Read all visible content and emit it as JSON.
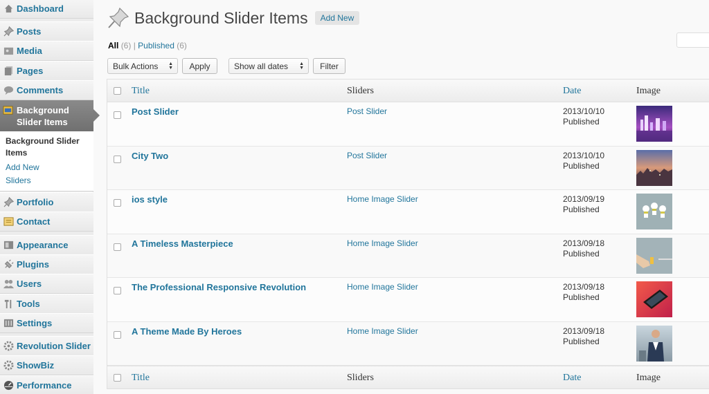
{
  "sidebar": {
    "dashboard": "Dashboard",
    "posts": "Posts",
    "media": "Media",
    "pages": "Pages",
    "comments": "Comments",
    "active": "Background Slider Items",
    "submenu": [
      "Background Slider Items",
      "Add New",
      "Sliders"
    ],
    "portfolio": "Portfolio",
    "contact": "Contact",
    "appearance": "Appearance",
    "plugins": "Plugins",
    "users": "Users",
    "tools": "Tools",
    "settings": "Settings",
    "revolution": "Revolution Slider",
    "showbiz": "ShowBiz",
    "performance": "Performance"
  },
  "header": {
    "title": "Background Slider Items",
    "add_new": "Add New"
  },
  "filters": {
    "all": "All",
    "all_count": "(6)",
    "separator": "|",
    "published": "Published",
    "published_count": "(6)"
  },
  "toolbar": {
    "bulk_actions": "Bulk Actions",
    "apply": "Apply",
    "dates": "Show all dates",
    "filter": "Filter"
  },
  "table": {
    "columns": {
      "title": "Title",
      "sliders": "Sliders",
      "date": "Date",
      "image": "Image"
    },
    "rows": [
      {
        "title": "Post Slider",
        "slider": "Post Slider",
        "date": "2013/10/10",
        "status": "Published",
        "image": "city-night-purple"
      },
      {
        "title": "City Two",
        "slider": "Post Slider",
        "date": "2013/10/10",
        "status": "Published",
        "image": "city-sunset"
      },
      {
        "title": "ios style",
        "slider": "Home Image Slider",
        "date": "2013/09/19",
        "status": "Published",
        "image": "figures-grey"
      },
      {
        "title": "A Timeless Masterpiece",
        "slider": "Home Image Slider",
        "date": "2013/09/18",
        "status": "Published",
        "image": "grey-hand"
      },
      {
        "title": "The Professional Responsive Revolution",
        "slider": "Home Image Slider",
        "date": "2013/09/18",
        "status": "Published",
        "image": "phone-red"
      },
      {
        "title": "A Theme Made By Heroes",
        "slider": "Home Image Slider",
        "date": "2013/09/18",
        "status": "Published",
        "image": "hero-man"
      }
    ]
  },
  "colors": {
    "link": "#21759b",
    "active_menu": "#7d7d7d"
  }
}
